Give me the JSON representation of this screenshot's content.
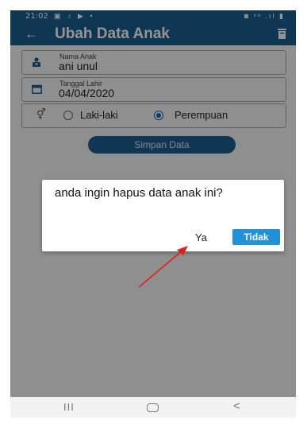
{
  "status_bar": {
    "time": "21:02",
    "left_icons": "▣ ♪ ▶ •",
    "right_icons": "◙ ᵛᵒ .ıl ▮"
  },
  "app_bar": {
    "title": "Ubah Data Anak",
    "back_icon": "arrow-left-icon",
    "delete_icon": "trash-icon",
    "color": "#1a5f91"
  },
  "form": {
    "name": {
      "label": "Nama Anak",
      "value": "ani unul",
      "icon": "child-icon"
    },
    "birth_date": {
      "label": "Tanggal Lahir",
      "value": "04/04/2020",
      "icon": "calendar-icon"
    },
    "gender": {
      "icon": "gender-icon",
      "options": [
        {
          "label": "Laki-laki",
          "selected": false
        },
        {
          "label": "Perempuan",
          "selected": true
        }
      ]
    },
    "save_button_label": "Simpan Data"
  },
  "dialog": {
    "message": "anda ingin hapus data anak ini?",
    "yes_label": "Ya",
    "no_label": "Tidak",
    "no_color": "#2192d9"
  },
  "annotation": {
    "arrow_color": "#e02020"
  },
  "nav_bar": {
    "recent_label": "III",
    "back_label": "<"
  }
}
